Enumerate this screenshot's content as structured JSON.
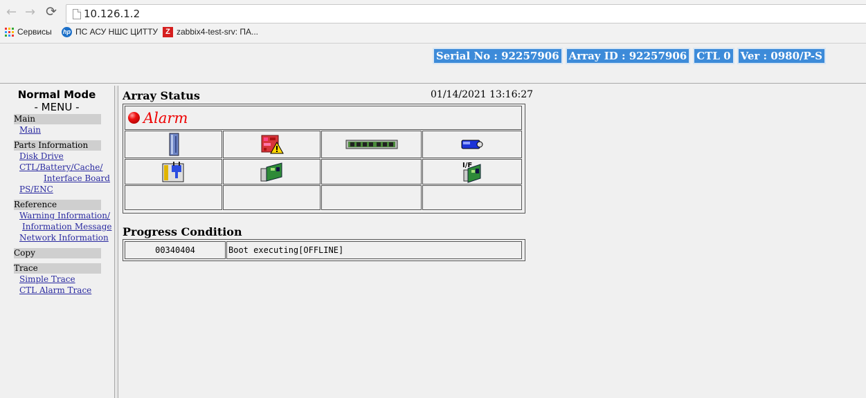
{
  "browser": {
    "url": "10.126.1.2",
    "bookmarks": [
      {
        "label": "Сервисы",
        "icon": "apps-grid-icon"
      },
      {
        "label": "ПС АСУ НШС ЦИТТУ",
        "icon": "hp-logo-icon"
      },
      {
        "label": "zabbix4-test-srv: ПА...",
        "icon": "zabbix-logo-icon"
      }
    ]
  },
  "header": {
    "serial": "Serial No : 92257906",
    "array_id": "Array ID : 92257906",
    "ctl": "CTL 0",
    "version": "Ver : 0980/P-S"
  },
  "menu": {
    "mode_title": "Normal Mode",
    "menu_label": "- MENU -",
    "sections": [
      {
        "title": "Main",
        "links": [
          "Main"
        ]
      },
      {
        "title": "Parts Information",
        "links": [
          "Disk Drive",
          "CTL/Battery/Cache/",
          "Interface Board",
          "PS/ENC"
        ]
      },
      {
        "title": "Reference",
        "links": [
          "Warning Information/",
          "Information Message",
          "Network Information"
        ]
      },
      {
        "title": "Copy",
        "links": []
      },
      {
        "title": "Trace",
        "links": [
          "Simple Trace",
          "CTL Alarm Trace"
        ]
      }
    ]
  },
  "array_status": {
    "title": "Array Status",
    "datetime": "01/14/2021 13:16:27",
    "alarm": "Alarm",
    "icons": [
      "disk-drive-icon",
      "controller-warning-icon",
      "cache-memory-icon",
      "battery-icon",
      "power-supply-icon",
      "enclosure-board-icon",
      "interface-board-icon"
    ],
    "iface_label": "I/F"
  },
  "progress": {
    "title": "Progress Condition",
    "code": "00340404",
    "message": "Boot executing[OFFLINE]"
  }
}
